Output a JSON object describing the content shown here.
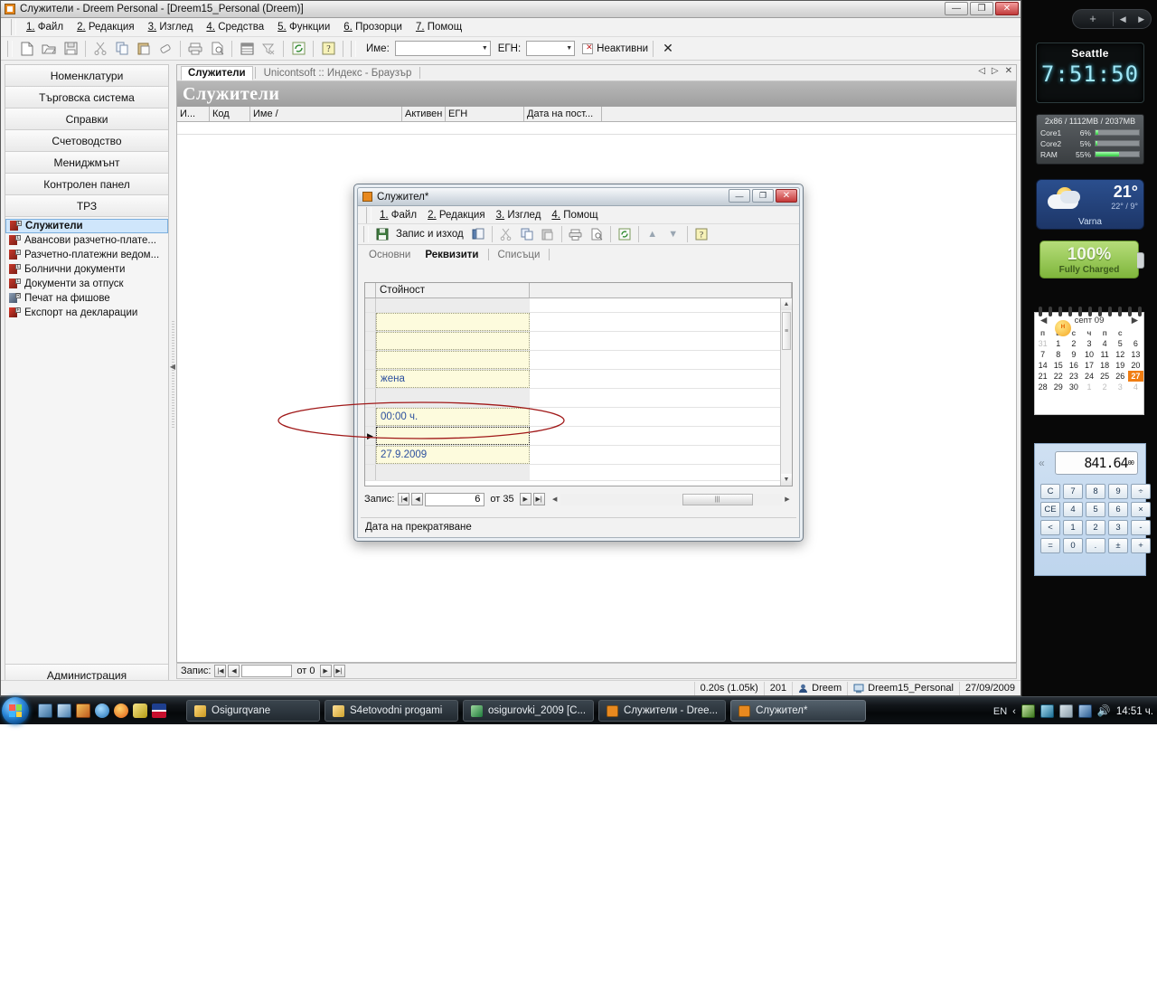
{
  "app": {
    "title": "Служители - Dreem Personal - [Dreem15_Personal (Dreem)]",
    "window_buttons": {
      "minimize": "—",
      "maximize": "❐",
      "close": "✕"
    },
    "menu": [
      {
        "num": "1.",
        "label": "Файл"
      },
      {
        "num": "2.",
        "label": "Редакция"
      },
      {
        "num": "3.",
        "label": "Изглед"
      },
      {
        "num": "4.",
        "label": "Средства"
      },
      {
        "num": "5.",
        "label": "Функции"
      },
      {
        "num": "6.",
        "label": "Прозорци"
      },
      {
        "num": "7.",
        "label": "Помощ"
      }
    ],
    "toolbar": {
      "icons": [
        "new-document-icon",
        "open-folder-icon",
        "save-icon",
        "cut-icon",
        "copy-icon",
        "paste-icon",
        "eraser-icon",
        "print-icon",
        "print-preview-icon",
        "table-icon",
        "filter-icon",
        "refresh-icon",
        "help-icon"
      ],
      "name_label": "Име:",
      "name_value": "",
      "egn_label": "ЕГН:",
      "egn_value": "",
      "inactive_label": "Неактивни",
      "close_label": "✕"
    }
  },
  "nav": {
    "buttons": [
      "Номенклатури",
      "Търговска система",
      "Справки",
      "Счетоводство",
      "Мениджмънт",
      "Контролен панел",
      "ТРЗ"
    ],
    "items": [
      {
        "label": "Служители",
        "badge": "L",
        "selected": true
      },
      {
        "label": "Авансови разчетно-плате...",
        "badge": "L",
        "selected": false
      },
      {
        "label": "Разчетно-платежни ведом...",
        "badge": "L",
        "selected": false
      },
      {
        "label": "Болнични документи",
        "badge": "L",
        "selected": false
      },
      {
        "label": "Документи за отпуск",
        "badge": "L",
        "selected": false
      },
      {
        "label": "Печат на фишове",
        "badge": "R",
        "selected": false
      },
      {
        "label": "Експорт на декларации",
        "badge": "F",
        "selected": false
      }
    ],
    "bottom_button": "Администрация"
  },
  "mdi": {
    "tabs": [
      {
        "label": "Служители",
        "active": true
      },
      {
        "label": "Unicontsoft :: Индекс - Браузър",
        "active": false
      }
    ],
    "controls": {
      "prev": "◁",
      "next": "▷",
      "close": "✕"
    },
    "page_title": "Служители",
    "grid_columns": [
      "И...",
      "Код",
      "Име /",
      "Активен",
      "ЕГН",
      "Дата на пост..."
    ],
    "record_nav": {
      "label": "Запис:",
      "first": "|◀",
      "prev": "◀",
      "value": "",
      "of": "от 0",
      "next": "▶",
      "last": "▶|"
    }
  },
  "status_bar": {
    "timing": "0.20s (1.05k)",
    "count": "201",
    "user": "Dreem",
    "database": "Dreem15_Personal",
    "date": "27/09/2009"
  },
  "dialog": {
    "title": "Служител*",
    "window_buttons": {
      "minimize": "—",
      "maximize": "❐",
      "close": "✕"
    },
    "menu": [
      {
        "num": "1.",
        "label": "Файл"
      },
      {
        "num": "2.",
        "label": "Редакция"
      },
      {
        "num": "3.",
        "label": "Изглед"
      },
      {
        "num": "4.",
        "label": "Помощ"
      }
    ],
    "toolbar": {
      "save_exit_label": "Запис и изход",
      "icons": [
        "save-icon",
        "save-copy-icon",
        "cut-icon",
        "copy-icon",
        "paste-icon",
        "print-icon",
        "print-preview-icon",
        "refresh-icon",
        "move-up-icon",
        "move-down-icon",
        "help-icon"
      ]
    },
    "tabs": [
      {
        "label": "Основни",
        "active": false
      },
      {
        "label": "Реквизити",
        "active": true
      },
      {
        "label": "Списъци",
        "active": false
      }
    ],
    "grid": {
      "column_header": "Стойност",
      "rows": [
        {
          "value": "",
          "blank": true,
          "current": false
        },
        {
          "value": "",
          "blank": false,
          "current": false
        },
        {
          "value": "",
          "blank": false,
          "current": false
        },
        {
          "value": "",
          "blank": false,
          "current": false
        },
        {
          "value": "жена",
          "blank": false,
          "current": false
        },
        {
          "value": "",
          "blank": true,
          "current": false
        },
        {
          "value": "00:00 ч.",
          "blank": false,
          "current": false
        },
        {
          "value": "",
          "blank": false,
          "current": true
        },
        {
          "value": "27.9.2009",
          "blank": false,
          "current": false
        },
        {
          "value": "",
          "blank": true,
          "current": false
        }
      ]
    },
    "record_nav": {
      "label": "Запис:",
      "first": "|◀",
      "prev": "◀",
      "value": "6",
      "of": "от 35",
      "next": "▶",
      "last": "▶|"
    },
    "status_text": "Дата на прекратяване"
  },
  "gadgets": {
    "header": {
      "add": "+",
      "prev": "◀",
      "next": "▶"
    },
    "clock": {
      "city": "Seattle",
      "time": "7:51:50"
    },
    "cpu": {
      "header": "2x86 / 1112MB / 2037MB",
      "rows": [
        {
          "label": "Core1",
          "pct": "6%",
          "width": 6
        },
        {
          "label": "Core2",
          "pct": "5%",
          "width": 5
        },
        {
          "label": "RAM",
          "pct": "55%",
          "width": 55
        }
      ]
    },
    "weather": {
      "temp": "21°",
      "high_low": "22° / 9°",
      "city": "Varna"
    },
    "battery": {
      "percent": "100%",
      "status": "Fully Charged"
    },
    "calendar": {
      "month": "септ 09",
      "prev": "◀",
      "next": "▶",
      "weekdays": [
        "п",
        "в",
        "с",
        "ч",
        "п",
        "с",
        "н"
      ],
      "weeks": [
        [
          {
            "d": "31",
            "dim": true
          },
          {
            "d": "1"
          },
          {
            "d": "2"
          },
          {
            "d": "3"
          },
          {
            "d": "4"
          },
          {
            "d": "5"
          },
          {
            "d": "6"
          }
        ],
        [
          {
            "d": "7"
          },
          {
            "d": "8"
          },
          {
            "d": "9"
          },
          {
            "d": "10"
          },
          {
            "d": "11"
          },
          {
            "d": "12"
          },
          {
            "d": "13"
          }
        ],
        [
          {
            "d": "14"
          },
          {
            "d": "15"
          },
          {
            "d": "16"
          },
          {
            "d": "17"
          },
          {
            "d": "18"
          },
          {
            "d": "19"
          },
          {
            "d": "20"
          }
        ],
        [
          {
            "d": "21"
          },
          {
            "d": "22"
          },
          {
            "d": "23"
          },
          {
            "d": "24"
          },
          {
            "d": "25"
          },
          {
            "d": "26"
          },
          {
            "d": "27",
            "today": true
          }
        ],
        [
          {
            "d": "28"
          },
          {
            "d": "29"
          },
          {
            "d": "30"
          },
          {
            "d": "1",
            "dim": true
          },
          {
            "d": "2",
            "dim": true
          },
          {
            "d": "3",
            "dim": true
          },
          {
            "d": "4",
            "dim": true
          }
        ]
      ]
    },
    "calculator": {
      "display": "841.64",
      "display_sup": "00",
      "collapse": "«",
      "keys": [
        "C",
        "7",
        "8",
        "9",
        "÷",
        "CE",
        "4",
        "5",
        "6",
        "×",
        "<",
        "1",
        "2",
        "3",
        "-",
        "=",
        "0",
        ".",
        "±",
        "+"
      ]
    }
  },
  "taskbar": {
    "quicklaunch": [
      "show-desktop-icon",
      "switch-window-icon",
      "media-icon",
      "internet-explorer-icon",
      "firefox-icon",
      "opera-icon",
      "uk-flag-icon"
    ],
    "tasks": [
      {
        "label": "Osigurqvane",
        "icon": "folder-icon",
        "active": false
      },
      {
        "label": "S4etovodni progami",
        "icon": "folder-icon",
        "active": false
      },
      {
        "label": "osigurovki_2009  [C...",
        "icon": "excel-icon",
        "active": false
      },
      {
        "label": "Служители - Dree...",
        "icon": "dreem-icon",
        "active": false
      },
      {
        "label": "Служител*",
        "icon": "dreem-icon",
        "active": true
      }
    ],
    "tray": {
      "language": "EN",
      "chevron": "‹",
      "icons": [
        "mail-icon",
        "volume-ctl-icon",
        "battery-icon",
        "network-icon",
        "speaker-icon"
      ],
      "clock": "14:51 ч."
    }
  },
  "colors": {
    "accent": "#2b4f9e",
    "selection": "#cfe6fb",
    "annotation": "#a01818",
    "field_bg": "#fdfbdd",
    "today": "#f07d12"
  }
}
